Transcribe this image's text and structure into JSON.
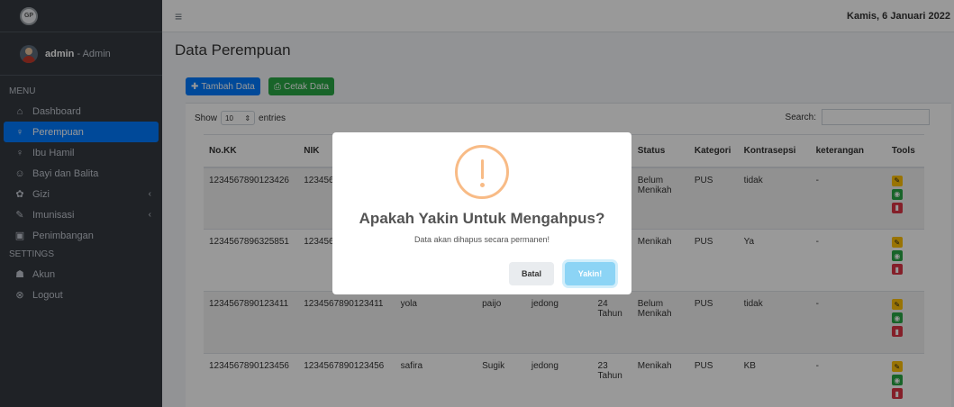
{
  "sidebar": {
    "brand_logo_text": "GP",
    "user": {
      "name": "admin",
      "role": "Admin",
      "separator": " - "
    },
    "menu_header": "MENU",
    "settings_header": "SETTINGS",
    "items": [
      {
        "label": "Dashboard",
        "icon": "home-icon",
        "glyph": "⌂"
      },
      {
        "label": "Perempuan",
        "icon": "female-icon",
        "glyph": "♀",
        "active": true
      },
      {
        "label": "Ibu Hamil",
        "icon": "pregnant-icon",
        "glyph": "♀"
      },
      {
        "label": "Bayi dan Balita",
        "icon": "baby-icon",
        "glyph": "☺"
      },
      {
        "label": "Gizi",
        "icon": "nutrition-icon",
        "glyph": "✿",
        "chevron": "‹"
      },
      {
        "label": "Imunisasi",
        "icon": "syringe-icon",
        "glyph": "✎",
        "chevron": "‹"
      },
      {
        "label": "Penimbangan",
        "icon": "scale-icon",
        "glyph": "▣"
      }
    ],
    "settings_items": [
      {
        "label": "Akun",
        "icon": "user-icon",
        "glyph": "☗"
      },
      {
        "label": "Logout",
        "icon": "logout-icon",
        "glyph": "⊗"
      }
    ]
  },
  "topbar": {
    "date": "Kamis, 6 Januari 2022"
  },
  "main": {
    "title": "Data Perempuan",
    "add_button": "Tambah Data",
    "print_button": "Cetak Data",
    "show_label": "Show",
    "entries_label": "entries",
    "entries_value": "10",
    "search_label": "Search:",
    "table": {
      "headers": [
        "No.KK",
        "NIK",
        "",
        "",
        "",
        "",
        "Status",
        "Kategori",
        "Kontrasepsi",
        "keterangan",
        "Tools"
      ],
      "rows": [
        [
          "1234567890123426",
          "1234567",
          "",
          "",
          "",
          "",
          "Belum Menikah",
          "PUS",
          "tidak",
          "-"
        ],
        [
          "1234567896325851",
          "1234567",
          "",
          "",
          "",
          "",
          "Menikah",
          "PUS",
          "Ya",
          "-"
        ],
        [
          "1234567890123411",
          "1234567890123411",
          "yola",
          "paijo",
          "jedong",
          "24 Tahun",
          "Belum Menikah",
          "PUS",
          "tidak",
          "-"
        ],
        [
          "1234567890123456",
          "1234567890123456",
          "safira",
          "Sugik",
          "jedong",
          "23 Tahun",
          "Menikah",
          "PUS",
          "KB",
          "-"
        ]
      ]
    }
  },
  "modal": {
    "title": "Apakah Yakin Untuk Mengahpus?",
    "text": "Data akan dihapus secara permanen!",
    "cancel_label": "Batal",
    "confirm_label": "Yakin!"
  },
  "colors": {
    "sidebar_bg": "#343a40",
    "active": "#007bff",
    "add_button": "#007bff",
    "print_button": "#28a745",
    "warning": "#f8bb86",
    "confirm": "#8cd4f5"
  }
}
